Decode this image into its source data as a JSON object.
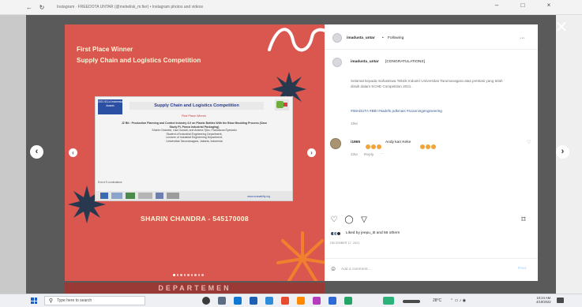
{
  "browser": {
    "tab_title": "Instagram · FREEDOTA UNTAR (@mebelisk_m.fier) • Instagram photos and videos"
  },
  "post_media": {
    "title_line1": "First Place Winner",
    "title_line2": "Supply Chain and Logistics Competition",
    "certificate": {
      "badge_text": "2021 SCLA Indonesia Awards",
      "title": "Supply Chain and Logistics Competition",
      "subtitle": "First Place Winner",
      "paper_title": "JZ Bit : Production Planning and Control Industry 4.0 on Plastic Bottles With the Blow Moulding Process (Case Study PL Panca Industrial Packaging)",
      "authors": "Sharin Chandra, Lisa Gunadi, and Andrea Tjiko, Franciscus Epeandu",
      "affiliation1": "Student of Industrial Engineering Department,",
      "affiliation2": "Lecturer of Industrial Engineering Department,",
      "affiliation3": "Universitas Tarumanagara, Jakarta, Indonesia",
      "footer": "End of E-nominations",
      "url": "www.scanabilty.org"
    },
    "winner_name": "SHARIN CHANDRA - 545170008",
    "bottom_strip_text": "DEPARTEMEN"
  },
  "post_panel": {
    "username": "imadusta_untar",
    "follow_dot": "•",
    "follow_label": "Following",
    "more_icon": "···",
    "caption_username": "imadusta_untar",
    "caption_headline": "[CONGRATULATIONS]",
    "caption_text": "Selamat kepada mahasiswa Teknik Industri Universitas Tarumanagara atas prestasi yang telah diraih dalam SCHE Competition 2021.",
    "hashtags": "#IMADUTA #BBI #sadefs pdkmais #scanningengineering",
    "caption_age": "19w",
    "comment": {
      "username": "i1965",
      "text": "Andy kan Keke",
      "age": "23w",
      "reply": "Reply",
      "more": "···"
    },
    "liked_by": "Liked by jeepu_tit and 56 others",
    "post_date": "DECEMBER 17, 2021",
    "comment_placeholder": "Add a comment...",
    "post_button": "Post"
  },
  "taskbar": {
    "search_placeholder": "Type here to search",
    "weather": "28°C",
    "time": "10:24 AM",
    "date": "4/19/2022"
  },
  "colors": {
    "post_red": "#d9574f",
    "navy_star": "#27384f",
    "orange_star": "#f08030",
    "accent_blue": "#0095f6"
  },
  "icons": {
    "close": "close-icon",
    "prev": "chevron-left-icon",
    "next": "chevron-right-icon",
    "like": "heart-icon",
    "comment": "comment-icon",
    "share": "share-icon",
    "save": "bookmark-icon",
    "emoji": "emoji-icon"
  }
}
